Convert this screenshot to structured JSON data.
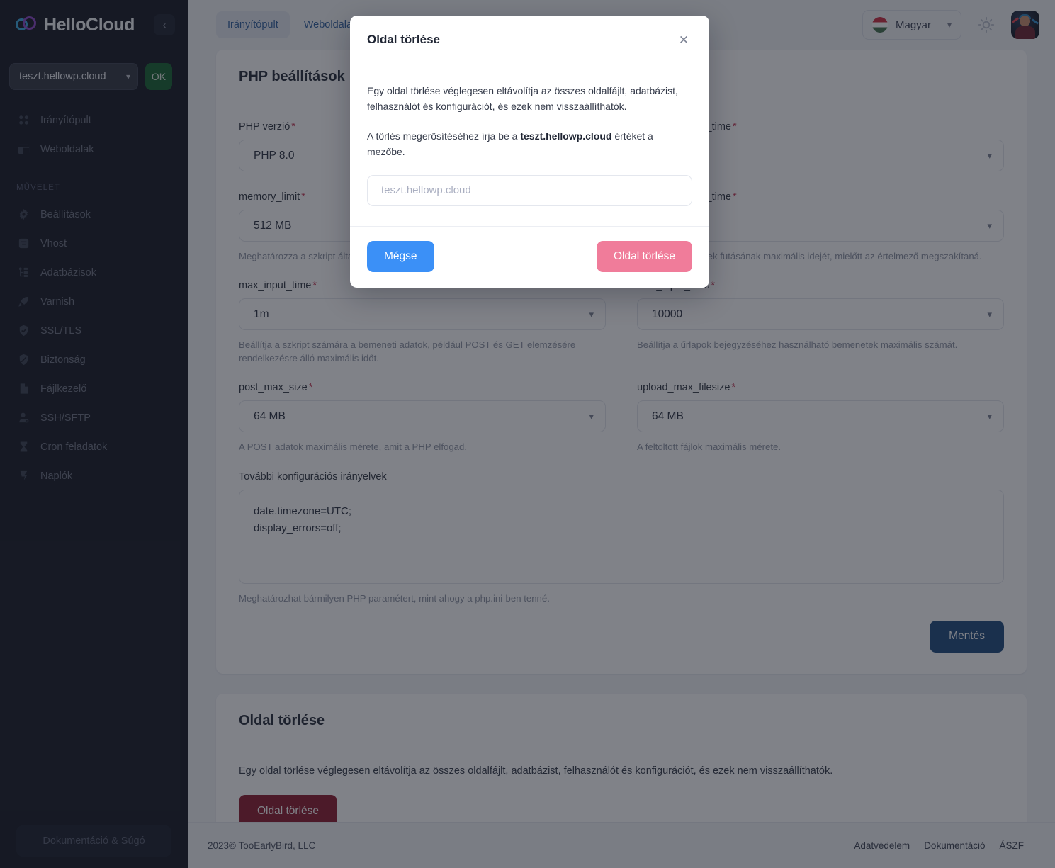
{
  "brand": {
    "name": "HelloCloud",
    "accent_purple": "#8b45c6",
    "accent_blue": "#3aa8e0"
  },
  "sidebar": {
    "collapse_icon": "chevron-left-icon",
    "site_selector": {
      "value": "teszt.hellowp.cloud",
      "chevron": "chevron-down-icon"
    },
    "ok_button": "OK",
    "ok_color": "#15622f",
    "nav_primary": [
      {
        "label": "Irányítópult",
        "icon": "grid-dots-icon"
      },
      {
        "label": "Weboldalak",
        "icon": "layout-icon"
      }
    ],
    "section_label": "MŰVELET",
    "nav_actions": [
      {
        "label": "Beállítások",
        "icon": "gear-icon"
      },
      {
        "label": "Vhost",
        "icon": "filter-lines-icon"
      },
      {
        "label": "Adatbázisok",
        "icon": "database-tree-icon"
      },
      {
        "label": "Varnish",
        "icon": "rocket-icon"
      },
      {
        "label": "SSL/TLS",
        "icon": "shield-check-icon"
      },
      {
        "label": "Biztonság",
        "icon": "shield-icon"
      },
      {
        "label": "Fájlkezelő",
        "icon": "file-icon"
      },
      {
        "label": "SSH/SFTP",
        "icon": "user-key-icon"
      },
      {
        "label": "Cron feladatok",
        "icon": "hourglass-icon"
      },
      {
        "label": "Naplók",
        "icon": "logs-icon"
      }
    ],
    "doc_button": "Dokumentáció & Súgó"
  },
  "topbar": {
    "tabs": [
      {
        "label": "Irányítópult",
        "active": true
      },
      {
        "label": "Weboldalak",
        "active": false
      }
    ],
    "language": {
      "label": "Magyar",
      "flag": "hungary-flag-icon",
      "chevron": "chevron-down-icon"
    },
    "theme_toggle_icon": "sun-icon",
    "avatar_icon": "user-avatar"
  },
  "php_card": {
    "title": "PHP beállítások",
    "fields": [
      {
        "label": "PHP verzió",
        "required": true,
        "value": "PHP 8.0",
        "help": "Meghatározza a szkript által lefoglalható maximális memóriamennyiséget."
      },
      {
        "label": "max_execution_time",
        "required": true,
        "value": "",
        "help": "Beállítja a szkriptek futásának maximális idejét, mielőtt az értelmező megszakítaná."
      },
      {
        "label": "memory_limit",
        "required": true,
        "value": "512 MB",
        "help": "Meghatározza a szkript által lefoglalható maximális memóriamennyiséget."
      },
      {
        "label": "max_input_time",
        "required": true,
        "value": "1m",
        "help": "Beállítja a szkript számára a bemeneti adatok, például POST és GET elemzésére rendelkezésre álló maximális időt."
      },
      {
        "label": "max_input_vars",
        "required": true,
        "value": "10000",
        "help": "Beállítja a űrlapok bejegyzéséhez használható bemenetek maximális számát."
      },
      {
        "label": "post_max_size",
        "required": true,
        "value": "64 MB",
        "help": "A POST adatok maximális mérete, amit a PHP elfogad."
      },
      {
        "label": "upload_max_filesize",
        "required": true,
        "value": "64 MB",
        "help": "A feltöltött fájlok maximális mérete."
      }
    ],
    "left_col": {
      "f1_label": "PHP verzió",
      "f1_value": "PHP 8.0",
      "f2_label": "memory_limit",
      "f2_value": "512 MB",
      "f2_help": "Meghatározza a szkript által lefoglalható maximális memóriamennyiséget.",
      "f3_label": "max_input_time",
      "f3_value": "1m",
      "f3_help": "Beállítja a szkript számára a bemeneti adatok, például POST és GET elemzésére rendelkezésre álló maximális időt.",
      "f4_label": "post_max_size",
      "f4_value": "64 MB",
      "f4_help": "A POST adatok maximális mérete, amit a PHP elfogad."
    },
    "right_col": {
      "f1_label": "max_execution_time",
      "f1_value": "",
      "f2_label": "max_execution_time",
      "f2_value": "",
      "f2_help": "Beállítja a szkriptek futásának maximális idejét, mielőtt az értelmező megszakítaná.",
      "f3_label": "max_input_vars",
      "f3_value": "10000",
      "f3_help": "Beállítja a űrlapok bejegyzéséhez használható bemenetek maximális számát.",
      "f4_label": "upload_max_filesize",
      "f4_value": "64 MB",
      "f4_help": "A feltöltött fájlok maximális mérete."
    },
    "extra": {
      "label": "További konfigurációs irányelvek",
      "value": "date.timezone=UTC;\ndisplay_errors=off;",
      "help": "Meghatározhat bármilyen PHP paramétert, mint ahogy a php.ini-ben tenné."
    },
    "save_label": "Mentés",
    "save_color": "#1d4a7c"
  },
  "delete_card": {
    "title": "Oldal törlése",
    "description": "Egy oldal törlése véglegesen eltávolítja az összes oldalfájlt, adatbázist, felhasználót és konfigurációt, és ezek nem visszaállíthatók.",
    "button_label": "Oldal törlése",
    "button_color": "#8d1a2e"
  },
  "footer": {
    "copyright": "2023© TooEarlyBird, LLC",
    "links": [
      "Adatvédelem",
      "Dokumentáció",
      "ÁSZF"
    ]
  },
  "modal": {
    "title": "Oldal törlése",
    "close_icon": "close-icon",
    "paragraph1": "Egy oldal törlése véglegesen eltávolítja az összes oldalfájlt, adatbázist, felhasználót és konfigurációt, és ezek nem visszaállíthatók.",
    "paragraph2_prefix": "A törlés megerősítéséhez írja be a ",
    "paragraph2_strong": "teszt.hellowp.cloud",
    "paragraph2_suffix": " értéket a mezőbe.",
    "input_placeholder": "teszt.hellowp.cloud",
    "input_value": "",
    "cancel_label": "Mégse",
    "cancel_color": "#3b90f7",
    "confirm_label": "Oldal törlése",
    "confirm_color": "#f07c9a",
    "confirm_disabled": true
  }
}
